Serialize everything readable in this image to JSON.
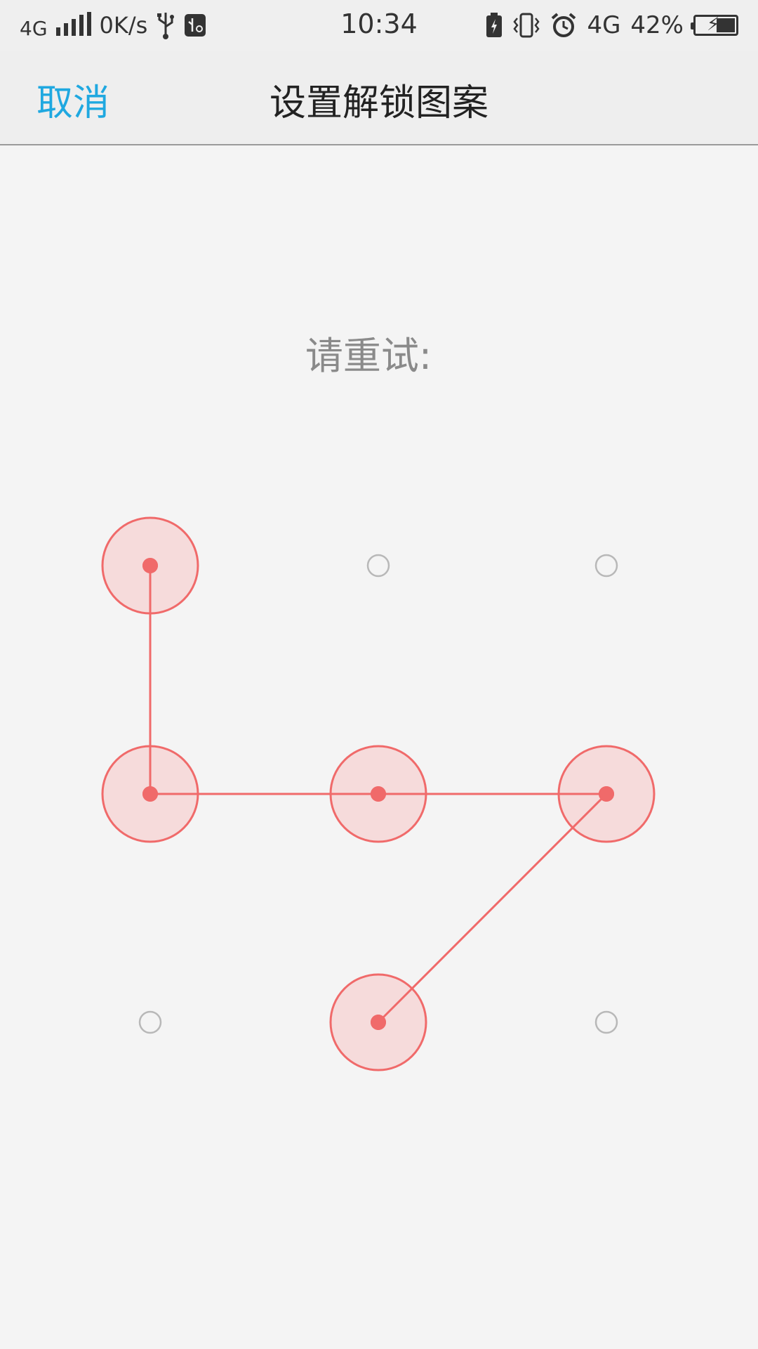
{
  "status_bar": {
    "network_left": "4G",
    "speed": "0K/s",
    "time": "10:34",
    "network_right": "4G",
    "battery_percent": "42%",
    "icons": [
      "signal-icon",
      "usb-icon",
      "usb-debug-icon",
      "battery-saver-icon",
      "vibrate-icon",
      "alarm-icon",
      "battery-charging-icon"
    ]
  },
  "nav": {
    "cancel_label": "取消",
    "title": "设置解锁图案"
  },
  "prompt": "请重试:",
  "pattern": {
    "grid": [
      3,
      3
    ],
    "selected_sequence": [
      1,
      4,
      5,
      6,
      8
    ],
    "state": "error",
    "colors": {
      "accent_error": "#f06a6a",
      "selected_fill": "#f6d6d6",
      "idle_ring": "#b8b8b8",
      "cancel_blue": "#1fa8e0"
    }
  }
}
